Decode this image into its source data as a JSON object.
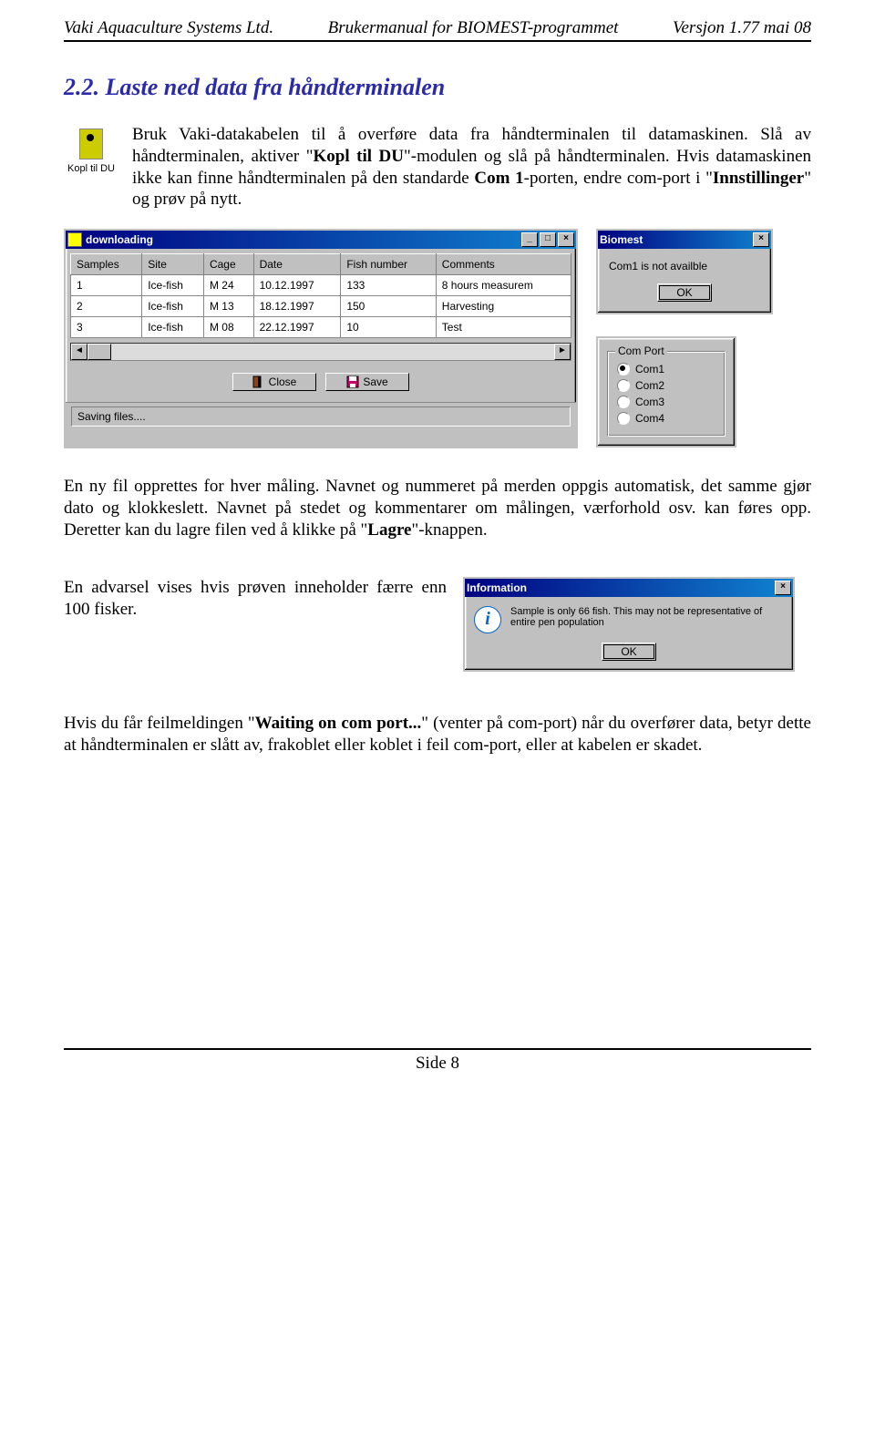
{
  "header": {
    "left": "Vaki Aquaculture Systems Ltd.",
    "center": "Brukermanual for BIOMEST-programmet",
    "right": "Versjon 1.77  mai 08"
  },
  "section_title": "2.2. Laste ned data fra håndterminalen",
  "kopl_icon_label": "Kopl til DU",
  "intro": {
    "p1_a": "Bruk Vaki-datakabelen til å overføre data fra håndterminalen til datamaskinen. Slå av håndterminalen, aktiver \"",
    "p1_bold1": "Kopl til DU",
    "p1_b": "\"-modulen og slå på håndterminalen. Hvis datamaskinen ikke kan finne håndterminalen på den standarde ",
    "p1_bold2": "Com 1",
    "p1_c": "-porten, endre com-port i \"",
    "p1_bold3": "Innstillinger",
    "p1_d": "\" og prøv på nytt."
  },
  "downloading": {
    "title": "downloading",
    "columns": [
      "Samples",
      "Site",
      "Cage",
      "Date",
      "Fish number",
      "Comments"
    ],
    "rows": [
      [
        "1",
        "Ice-fish",
        "M 24",
        "10.12.1997",
        "133",
        "8 hours measurem"
      ],
      [
        "2",
        "Ice-fish",
        "M 13",
        "18.12.1997",
        "150",
        "Harvesting"
      ],
      [
        "3",
        "Ice-fish",
        "M 08",
        "22.12.1997",
        "10",
        "Test"
      ]
    ],
    "close_label": "Close",
    "save_label": "Save",
    "status": "Saving files...."
  },
  "biomest": {
    "title": "Biomest",
    "message": "Com1 is not availble",
    "ok": "OK"
  },
  "comport": {
    "legend": "Com Port",
    "options": [
      "Com1",
      "Com2",
      "Com3",
      "Com4"
    ],
    "selected": 0
  },
  "middle": {
    "a": "En ny fil opprettes for hver måling. Navnet og nummeret på merden oppgis automatisk, det samme gjør dato og klokkeslett. Navnet på stedet og kommentarer om målingen, værforhold osv. kan føres opp. Deretter kan du lagre filen ved å klikke på \"",
    "bold": "Lagre",
    "b": "\"-knappen."
  },
  "warning_text": "En advarsel vises hvis prøven inneholder færre enn 100 fisker.",
  "info_dialog": {
    "title": "Information",
    "message": "Sample is only 66 fish. This may not be representative of entire pen population",
    "ok": "OK"
  },
  "bottom": {
    "a": "Hvis du får feilmeldingen \"",
    "bold": "Waiting on com port...",
    "b": "\" (venter på com-port) når du overfører data, betyr dette at håndterminalen er slått av, frakoblet eller koblet i feil com-port, eller at kabelen er skadet."
  },
  "footer": "Side 8"
}
